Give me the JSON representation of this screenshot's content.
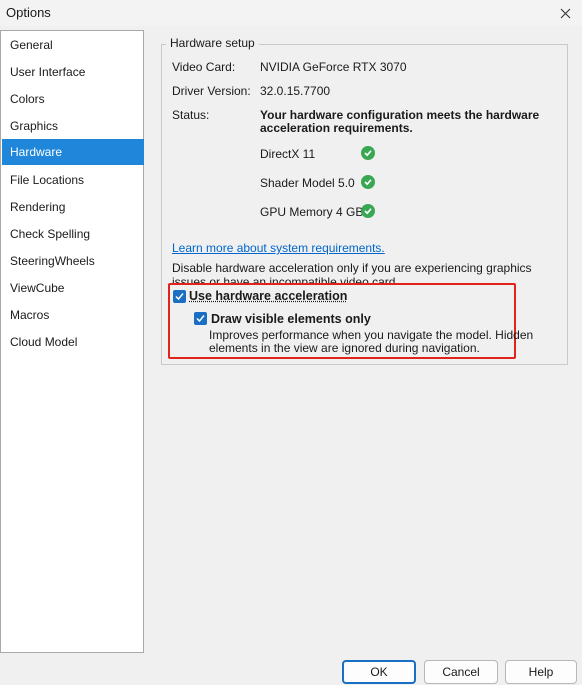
{
  "window": {
    "title": "Options"
  },
  "sidebar": {
    "items": [
      {
        "label": "General"
      },
      {
        "label": "User Interface"
      },
      {
        "label": "Colors"
      },
      {
        "label": "Graphics"
      },
      {
        "label": "Hardware"
      },
      {
        "label": "File Locations"
      },
      {
        "label": "Rendering"
      },
      {
        "label": "Check Spelling"
      },
      {
        "label": "SteeringWheels"
      },
      {
        "label": "ViewCube"
      },
      {
        "label": "Macros"
      },
      {
        "label": "Cloud Model"
      }
    ],
    "selected": "Hardware"
  },
  "hardware": {
    "group_title": "Hardware setup",
    "video_card_label": "Video Card:",
    "video_card_value": "NVIDIA GeForce RTX 3070",
    "driver_label": "Driver Version:",
    "driver_value": "32.0.15.7700",
    "status_label": "Status:",
    "status_line1": "Your hardware configuration meets the hardware",
    "status_line2": "acceleration requirements.",
    "requirements": [
      {
        "label": "DirectX 11",
        "icon": "check-circle-icon",
        "status_color": "#3aa853"
      },
      {
        "label": "Shader Model 5.0",
        "icon": "check-circle-icon",
        "status_color": "#3aa853"
      },
      {
        "label": "GPU Memory 4 GB",
        "icon": "check-circle-icon",
        "status_color": "#3aa853"
      }
    ],
    "link_text": "Learn more about system requirements.",
    "disable_note": "Disable hardware acceleration only if you are experiencing graphics issues or have an incompatible video card.",
    "use_accel_label": "Use hardware acceleration",
    "use_accel_checked": true,
    "draw_visible_label": "Draw visible elements only",
    "draw_visible_checked": true,
    "draw_visible_desc": "Improves performance when you navigate the model. Hidden elements in the view are ignored during navigation."
  },
  "buttons": {
    "ok": "OK",
    "cancel": "Cancel",
    "help": "Help"
  },
  "colors": {
    "accent": "#1f86d9",
    "highlight_border": "#e0241b",
    "link": "#0066cc"
  }
}
